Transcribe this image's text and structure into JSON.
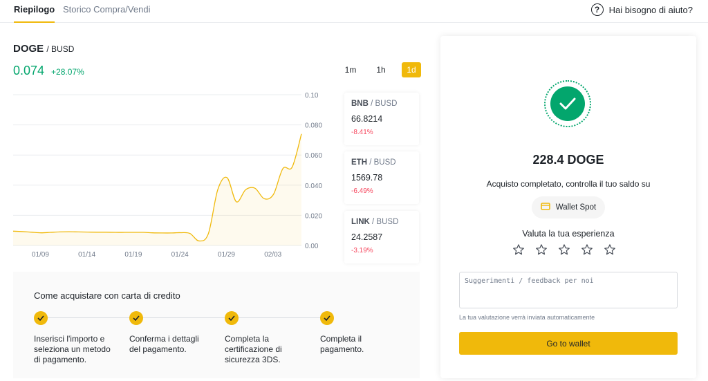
{
  "tabs": [
    {
      "label": "Riepilogo"
    },
    {
      "label": "Storico Compra/Vendi"
    }
  ],
  "help": {
    "label": "Hai bisogno di aiuto?",
    "icon": "question-circle-icon"
  },
  "pair": {
    "base": "DOGE",
    "quote": "/ BUSD",
    "price": "0.074",
    "change": "+28.07%"
  },
  "timeframes": [
    {
      "label": "1m"
    },
    {
      "label": "1h"
    },
    {
      "label": "1d",
      "active": true
    }
  ],
  "chart_data": {
    "type": "area",
    "x": [
      "01/07",
      "01/08",
      "01/09",
      "01/10",
      "01/11",
      "01/12",
      "01/13",
      "01/14",
      "01/15",
      "01/16",
      "01/17",
      "01/18",
      "01/19",
      "01/20",
      "01/21",
      "01/22",
      "01/23",
      "01/24",
      "01/25",
      "01/26",
      "01/27",
      "01/28",
      "01/29",
      "01/30",
      "01/31",
      "02/01",
      "02/02",
      "02/03",
      "02/04",
      "02/05",
      "02/06",
      "02/07"
    ],
    "values": [
      0.0095,
      0.0092,
      0.0088,
      0.0084,
      0.0087,
      0.009,
      0.0091,
      0.009,
      0.0089,
      0.0088,
      0.0088,
      0.0087,
      0.0087,
      0.0087,
      0.0087,
      0.0084,
      0.0083,
      0.0083,
      0.0085,
      0.008,
      0.003,
      0.008,
      0.037,
      0.045,
      0.029,
      0.037,
      0.038,
      0.031,
      0.034,
      0.051,
      0.052,
      0.074
    ],
    "xticks": [
      "01/09",
      "01/14",
      "01/19",
      "01/24",
      "01/29",
      "02/03"
    ],
    "yticks": [
      "0.00",
      "0.020",
      "0.040",
      "0.060",
      "0.080",
      "0.10"
    ],
    "ylim": [
      0,
      0.1
    ],
    "grid": true,
    "line_color": "#f0b90b"
  },
  "tickers": [
    {
      "base": "BNB",
      "quote": "/ BUSD",
      "price": "66.8214",
      "change": "-8.41%"
    },
    {
      "base": "ETH",
      "quote": "/ BUSD",
      "price": "1569.78",
      "change": "-6.49%"
    },
    {
      "base": "LINK",
      "quote": "/ BUSD",
      "price": "24.2587",
      "change": "-3.19%"
    }
  ],
  "howto": {
    "title": "Come acquistare con carta di credito",
    "steps": [
      "Inserisci l'importo e seleziona un metodo di pagamento.",
      "Conferma i dettagli del pagamento.",
      "Completa la certificazione di sicurezza 3DS.",
      "Completa il pagamento."
    ]
  },
  "result": {
    "amount": "228.4 DOGE",
    "message": "Acquisto completato, controlla il tuo saldo su",
    "wallet_label": "Wallet Spot",
    "rate_title": "Valuta la tua esperienza",
    "stars": 5,
    "feedback_placeholder": "Suggerimenti / feedback per noi",
    "note": "La tua valutazione verrà inviata automaticamente",
    "button": "Go to wallet"
  },
  "colors": {
    "accent": "#f0b90b",
    "positive": "#03a66d",
    "negative": "#f6465d"
  }
}
